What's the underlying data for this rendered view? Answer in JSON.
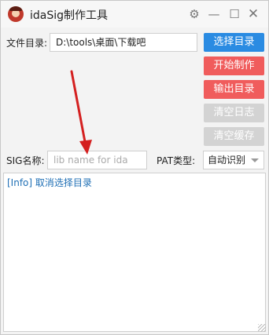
{
  "app": {
    "title": "idaSig制作工具"
  },
  "titlebar": {
    "settings_icon": "gear-icon",
    "minimize_icon": "minimize-icon",
    "maximize_icon": "maximize-icon",
    "close_icon": "close-icon"
  },
  "form": {
    "dir_label": "文件目录:",
    "dir_value": "D:\\tools\\桌面\\下载吧",
    "sig_label": "SIG名称:",
    "sig_placeholder": "lib name for ida",
    "pat_label": "PAT类型:",
    "pat_selected": "自动识别"
  },
  "buttons": {
    "choose_dir": "选择目录",
    "start": "开始制作",
    "output_dir": "输出目录",
    "clear_log": "清空日志",
    "clear_cache": "清空缓存"
  },
  "log": {
    "lines": [
      "[Info] 取消选择目录"
    ]
  },
  "colors": {
    "primary": "#2a8be2",
    "danger": "#f05c5c",
    "disabled": "#d3d3d3",
    "annotation_arrow": "#d42020"
  }
}
